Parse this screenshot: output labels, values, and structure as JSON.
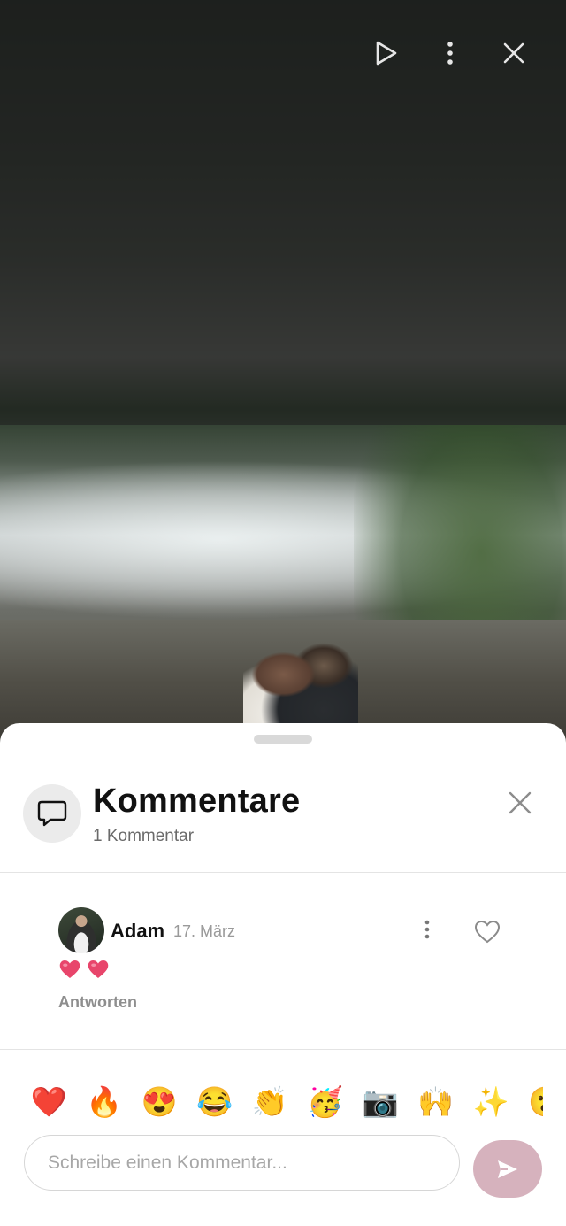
{
  "topbar": {
    "play_icon": "play-icon",
    "more_icon": "more-vertical-icon",
    "close_icon": "close-icon"
  },
  "sheet": {
    "title": "Kommentare",
    "count_label": "1 Kommentar",
    "icon": "comment-icon",
    "close_icon": "close-icon"
  },
  "comments": [
    {
      "author": "Adam",
      "date": "17. März",
      "body": "❤️ ❤️",
      "reply_label": "Antworten"
    }
  ],
  "emoji_bar": [
    "❤️",
    "🔥",
    "😍",
    "😂",
    "👏",
    "🥳",
    "📷",
    "🙌",
    "✨",
    "😮"
  ],
  "composer": {
    "placeholder": "Schreibe einen Kommentar...",
    "value": "",
    "send_icon": "send-icon"
  },
  "colors": {
    "send_button": "#d6b2bd",
    "heart": "#e8456b",
    "title": "#111111",
    "muted": "#9a9a9a"
  }
}
